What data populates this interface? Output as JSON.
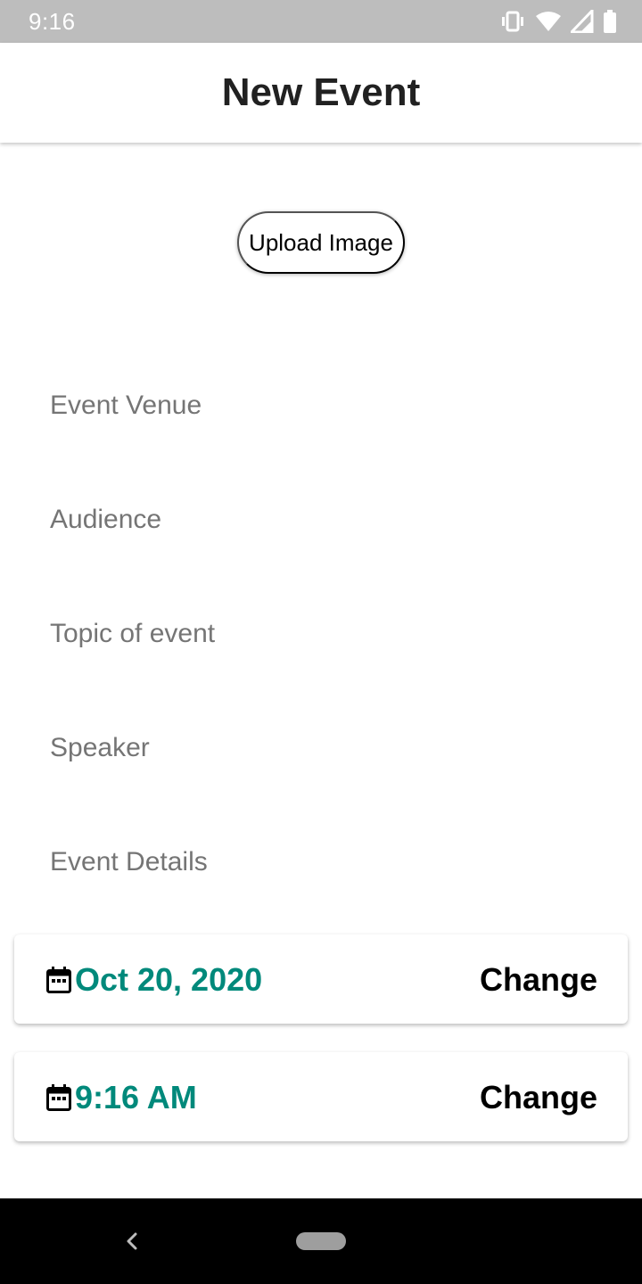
{
  "status_bar": {
    "time": "9:16",
    "icons": [
      "vibrate-icon",
      "wifi-icon",
      "cell-signal-icon",
      "battery-icon"
    ]
  },
  "app_bar": {
    "title": "New Event"
  },
  "upload": {
    "label": "Upload Image"
  },
  "form": {
    "venue": {
      "placeholder": "Event Venue",
      "value": ""
    },
    "audience": {
      "placeholder": "Audience",
      "value": ""
    },
    "topic": {
      "placeholder": "Topic of event",
      "value": ""
    },
    "speaker": {
      "placeholder": "Speaker",
      "value": ""
    },
    "details": {
      "placeholder": "Event Details",
      "value": ""
    }
  },
  "date_card": {
    "icon": "calendar-icon",
    "value": "Oct 20, 2020",
    "action": "Change"
  },
  "time_card": {
    "icon": "calendar-icon",
    "value": "9:16 AM",
    "action": "Change"
  },
  "nav_bar": {
    "back_icon": "back-chevron-icon",
    "home_icon": "home-pill-icon"
  },
  "colors": {
    "accent": "#00897b",
    "status_bar": "#bdbdbd",
    "title": "#212121",
    "placeholder": "#757575",
    "nav_bar": "#000000"
  }
}
